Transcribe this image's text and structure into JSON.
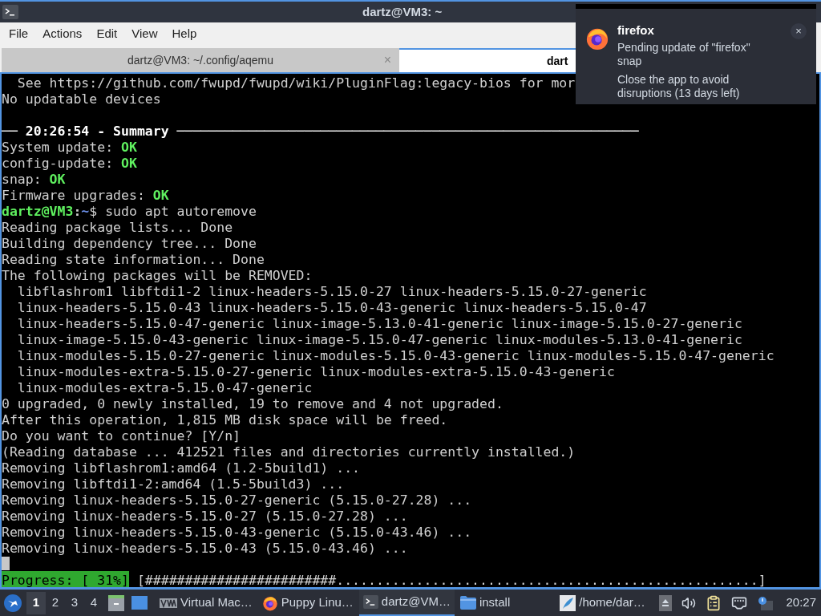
{
  "window": {
    "title": "dartz@VM3: ~"
  },
  "menu": [
    "File",
    "Actions",
    "Edit",
    "View",
    "Help"
  ],
  "tabs": [
    {
      "label": "dartz@VM3: ~/.config/aqemu",
      "selected": false,
      "close": "×"
    },
    {
      "label": "dart",
      "selected": true
    }
  ],
  "terminal": {
    "lines": [
      {
        "kind": "text",
        "text": "  See https://github.com/fwupd/fwupd/wiki/PluginFlag:legacy-bios for mor"
      },
      {
        "kind": "text",
        "text": "No updatable devices"
      },
      {
        "kind": "blank"
      },
      {
        "kind": "heading",
        "text": "── 20:26:54 - Summary ──────────────────────────────────────────────────────────"
      },
      {
        "kind": "status",
        "label": "System update:",
        "status": "OK"
      },
      {
        "kind": "status",
        "label": "config-update:",
        "status": "OK"
      },
      {
        "kind": "status",
        "label": "snap:",
        "status": "OK"
      },
      {
        "kind": "status",
        "label": "Firmware upgrades:",
        "status": "OK"
      },
      {
        "kind": "prompt",
        "user": "dartz@VM3",
        "sep": ":",
        "path": "~",
        "sign": "$",
        "command": "sudo apt autoremove"
      },
      {
        "kind": "text",
        "text": "Reading package lists... Done"
      },
      {
        "kind": "text",
        "text": "Building dependency tree... Done"
      },
      {
        "kind": "text",
        "text": "Reading state information... Done"
      },
      {
        "kind": "text",
        "text": "The following packages will be REMOVED:"
      },
      {
        "kind": "text",
        "text": "  libflashrom1 libftdi1-2 linux-headers-5.15.0-27 linux-headers-5.15.0-27-generic"
      },
      {
        "kind": "text",
        "text": "  linux-headers-5.15.0-43 linux-headers-5.15.0-43-generic linux-headers-5.15.0-47"
      },
      {
        "kind": "text",
        "text": "  linux-headers-5.15.0-47-generic linux-image-5.13.0-41-generic linux-image-5.15.0-27-generic"
      },
      {
        "kind": "text",
        "text": "  linux-image-5.15.0-43-generic linux-image-5.15.0-47-generic linux-modules-5.13.0-41-generic"
      },
      {
        "kind": "text",
        "text": "  linux-modules-5.15.0-27-generic linux-modules-5.15.0-43-generic linux-modules-5.15.0-47-generic"
      },
      {
        "kind": "text",
        "text": "  linux-modules-extra-5.15.0-27-generic linux-modules-extra-5.15.0-43-generic"
      },
      {
        "kind": "text",
        "text": "  linux-modules-extra-5.15.0-47-generic"
      },
      {
        "kind": "text",
        "text": "0 upgraded, 0 newly installed, 19 to remove and 4 not upgraded."
      },
      {
        "kind": "text",
        "text": "After this operation, 1,815 MB disk space will be freed."
      },
      {
        "kind": "text",
        "text": "Do you want to continue? [Y/n]"
      },
      {
        "kind": "text",
        "text": "(Reading database ... 412521 files and directories currently installed.)"
      },
      {
        "kind": "text",
        "text": "Removing libflashrom1:amd64 (1.2-5build1) ..."
      },
      {
        "kind": "text",
        "text": "Removing libftdi1-2:amd64 (1.5-5build3) ..."
      },
      {
        "kind": "text",
        "text": "Removing linux-headers-5.15.0-27-generic (5.15.0-27.28) ..."
      },
      {
        "kind": "text",
        "text": "Removing linux-headers-5.15.0-27 (5.15.0-27.28) ..."
      },
      {
        "kind": "text",
        "text": "Removing linux-headers-5.15.0-43-generic (5.15.0-43.46) ..."
      },
      {
        "kind": "text",
        "text": "Removing linux-headers-5.15.0-43 (5.15.0-43.46) ..."
      },
      {
        "kind": "cursor"
      }
    ],
    "progress": {
      "label": "Progress: [ 31%]",
      "bar": "[########################.....................................................]"
    }
  },
  "notification": {
    "app": "firefox",
    "message": "Pending update of \"firefox\" snap",
    "detail": "Close the app to avoid disruptions (13 days left)",
    "close": "×"
  },
  "taskbar": {
    "workspaces": [
      {
        "label": "1",
        "selected": true
      },
      {
        "label": "2",
        "selected": false
      },
      {
        "label": "3",
        "selected": false
      },
      {
        "label": "4",
        "selected": false
      }
    ],
    "tasks": [
      {
        "kind": "vm",
        "label": "Virtual Mac…",
        "selected": false
      },
      {
        "kind": "browser",
        "label": "Puppy Linu…",
        "selected": false
      },
      {
        "kind": "terminal",
        "label": "dartz@VM…",
        "selected": true
      },
      {
        "kind": "folder",
        "label": "install",
        "selected": false
      },
      {
        "kind": "editor",
        "label": "/home/dar…",
        "selected": false
      }
    ],
    "clock": "20:27"
  }
}
